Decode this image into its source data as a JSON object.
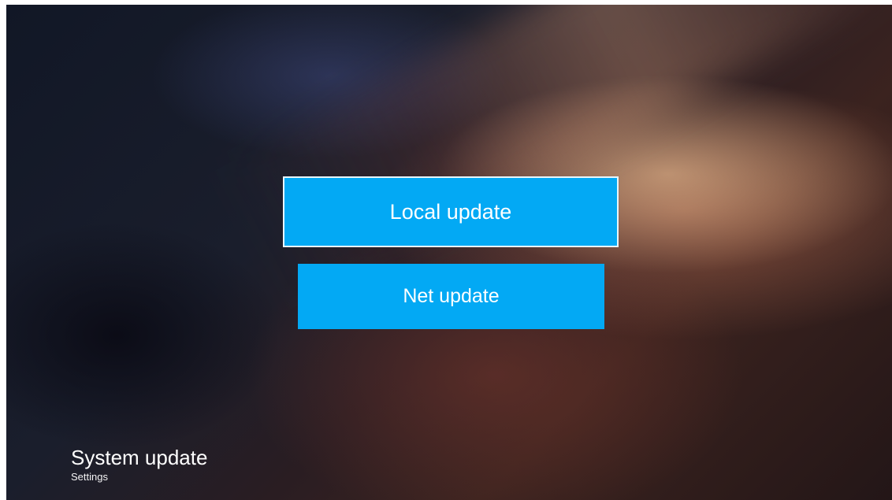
{
  "background": {
    "theme": "space-nebula"
  },
  "menu": {
    "items": [
      {
        "label": "Local update",
        "focused": true
      },
      {
        "label": "Net update",
        "focused": false
      }
    ]
  },
  "footer": {
    "title": "System update",
    "subtitle": "Settings"
  },
  "colors": {
    "button": "#03a9f4",
    "focus_border": "#e8f6ff",
    "text": "#ffffff"
  }
}
